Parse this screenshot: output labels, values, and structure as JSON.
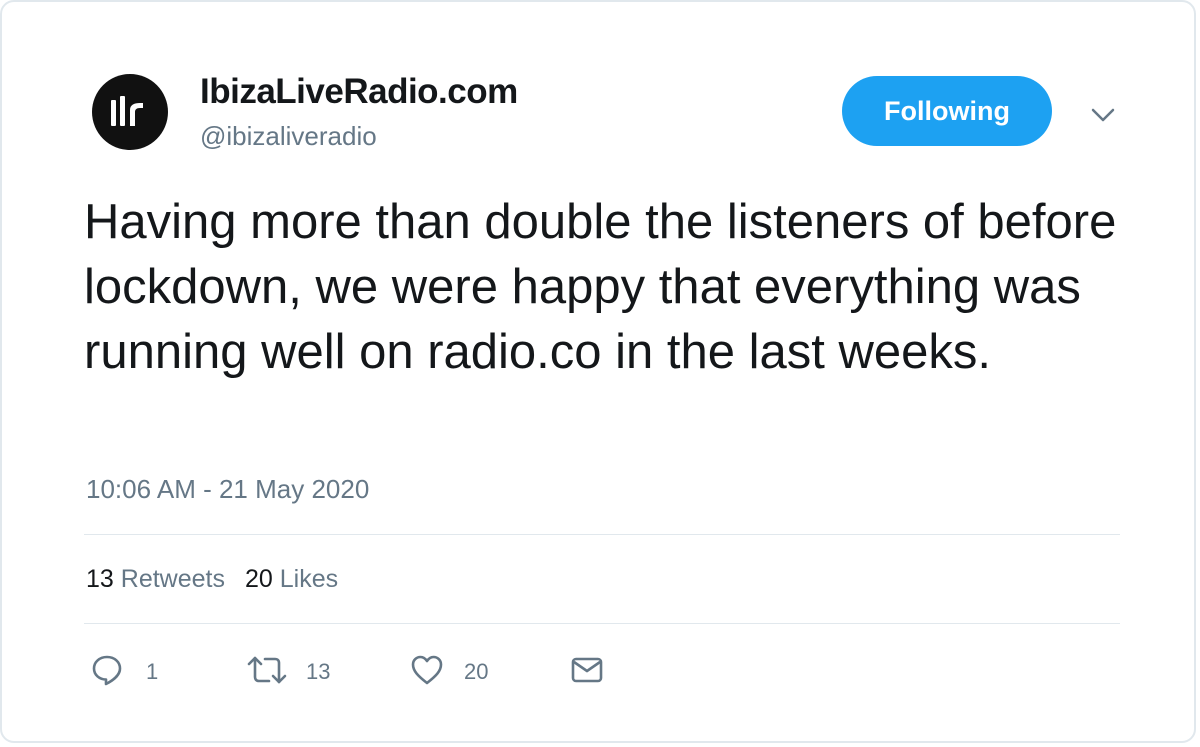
{
  "account": {
    "display_name": "IbizaLiveRadio.com",
    "handle": "@ibizaliveradio",
    "avatar_icon": "ilr-logo-icon"
  },
  "follow_button": {
    "label": "Following"
  },
  "tweet": {
    "text": "Having more than double the listeners of before lockdown, we were happy that everything was running well on radio.co in the last weeks.",
    "timestamp": "10:06 AM - 21 May 2020"
  },
  "stats": {
    "retweets_count": "13",
    "retweets_label": "Retweets",
    "likes_count": "20",
    "likes_label": "Likes"
  },
  "actions": {
    "reply_count": "1",
    "retweet_count": "13",
    "like_count": "20"
  },
  "colors": {
    "accent": "#1da1f2",
    "text_primary": "#14171a",
    "text_secondary": "#657786",
    "border": "#e1e8ed"
  }
}
